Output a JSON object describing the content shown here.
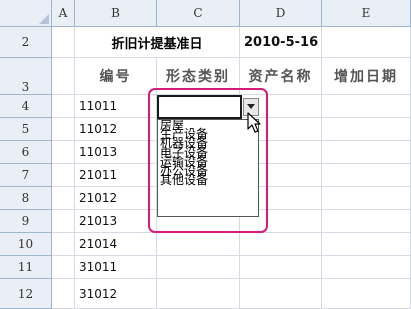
{
  "colors": {
    "header_bg": "#eaeef5",
    "highlight": "#d81b7a",
    "gridline": "#d6dbe3"
  },
  "columns": [
    "A",
    "B",
    "C",
    "D",
    "E"
  ],
  "rows": [
    "2",
    "3",
    "4",
    "5",
    "6",
    "7",
    "8",
    "9",
    "10",
    "11",
    "12"
  ],
  "row2": {
    "title": "折旧计提基准日",
    "date": "2010-5-16"
  },
  "row3": {
    "b": "编号",
    "c": "形态类别",
    "d": "资产名称",
    "e": "增加日期"
  },
  "ids": [
    "11011",
    "11012",
    "11013",
    "21011",
    "21012",
    "21013",
    "21014",
    "31011",
    "31012"
  ],
  "active_cell_value": "",
  "dropdown": {
    "button_icon": "triangle-down-icon",
    "options": [
      "房屋",
      "生产设备",
      "机器设备",
      "电子设备",
      "运输设备",
      "办公设备",
      "其他设备"
    ]
  },
  "cursor_icon": "mouse-pointer-icon"
}
